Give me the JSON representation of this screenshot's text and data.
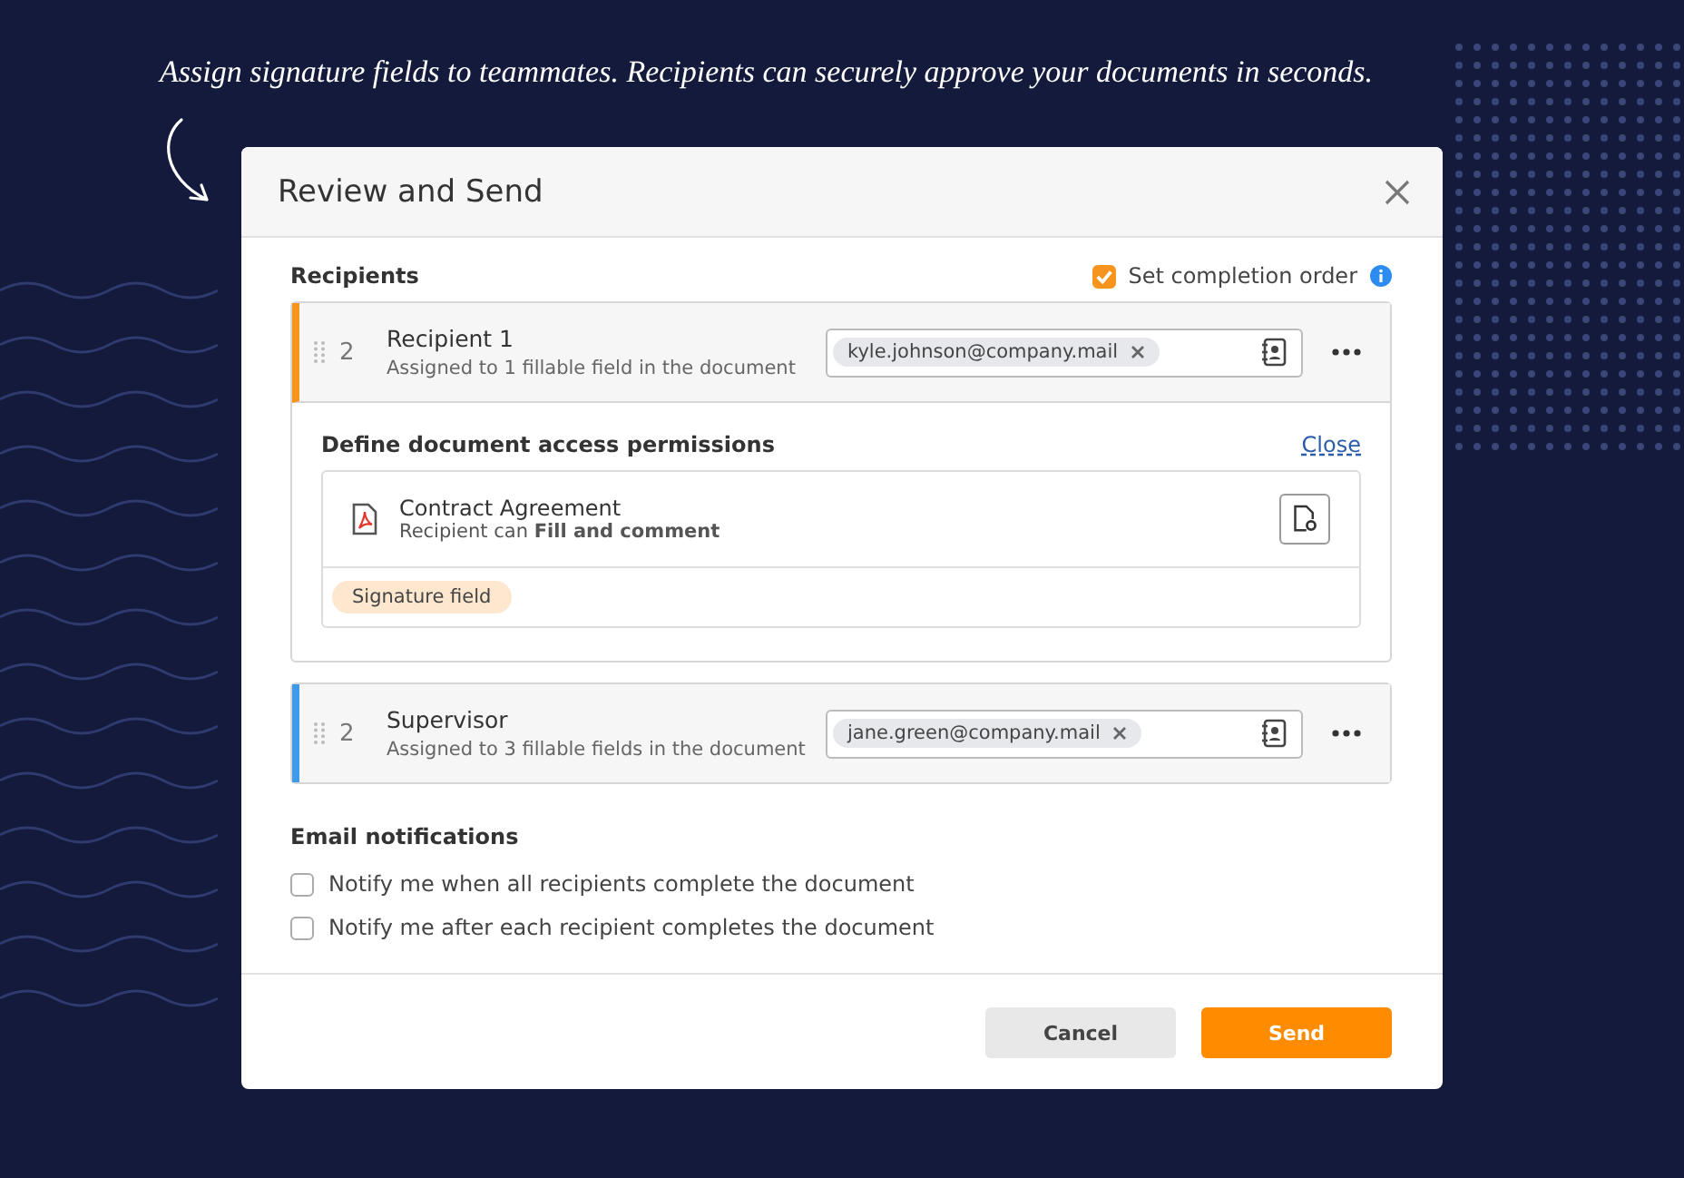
{
  "caption": "Assign signature fields to teammates. Recipients can securely approve your documents in seconds.",
  "dialog": {
    "title": "Review and Send"
  },
  "recipients_section": {
    "label": "Recipients",
    "completion_order": {
      "label": "Set completion order",
      "checked": true
    }
  },
  "recipients": [
    {
      "order": "2",
      "name": "Recipient 1",
      "assigned": "Assigned to 1 fillable field in the document",
      "email": "kyle.johnson@company.mail",
      "color": "#f7941d",
      "expanded": true,
      "permissions": {
        "title": "Define document access permissions",
        "close": "Close",
        "document": "Contract Agreement",
        "access": "Recipient can **Fill and comment**",
        "tags": [
          "Signature field"
        ]
      }
    },
    {
      "order": "2",
      "name": "Supervisor",
      "assigned": "Assigned to 3 fillable fields in the document",
      "email": "jane.green@company.mail",
      "color": "#3d9be9",
      "expanded": false
    }
  ],
  "email_notifications": {
    "label": "Email notifications",
    "options": [
      {
        "label": "Notify me when all recipients complete the document",
        "checked": false
      },
      {
        "label": "Notify me after each recipient completes the document",
        "checked": false
      }
    ]
  },
  "buttons": [
    {
      "label": "Cancel",
      "kind": "secondary"
    },
    {
      "label": "Send",
      "kind": "primary"
    }
  ]
}
